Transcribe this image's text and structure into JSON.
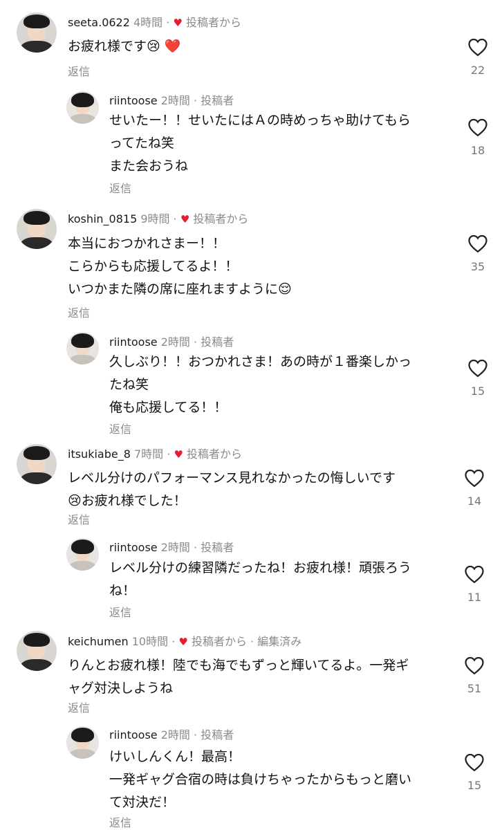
{
  "comments": [
    {
      "username": "seeta.0622",
      "time": "4時間",
      "sep": "·",
      "badge": "投稿者から",
      "lines": [
        "お疲れ様です😢 ❤️"
      ],
      "reply": "返信",
      "likes": "22"
    },
    {
      "username": "riintoose",
      "time": "2時間",
      "sep": "·",
      "badge": "投稿者",
      "lines": [
        "せいたー！！せいたにはＡの時めっちゃ助けてもら",
        "ってたね笑",
        "また会おうね"
      ],
      "reply": "返信",
      "likes": "18"
    },
    {
      "username": "koshin_0815",
      "time": "9時間",
      "sep": "·",
      "badge": "投稿者から",
      "lines": [
        "本当におつかれさまー！！",
        "こらからも応援してるよ！！",
        "いつかまた隣の席に座れますように😌"
      ],
      "reply": "返信",
      "likes": "35"
    },
    {
      "username": "riintoose",
      "time": "2時間",
      "sep": "·",
      "badge": "投稿者",
      "lines": [
        "久しぶり！！おつかれさま！あの時が１番楽しかっ",
        "たね笑",
        "俺も応援してる！！"
      ],
      "reply": "返信",
      "likes": "15"
    },
    {
      "username": "itsukiabe_8",
      "time": "7時間",
      "sep": "·",
      "badge": "投稿者から",
      "lines": [
        "レベル分けのパフォーマンス見れなかったの悔しいです",
        "😢お疲れ様でした！"
      ],
      "reply": "返信",
      "likes": "14"
    },
    {
      "username": "riintoose",
      "time": "2時間",
      "sep": "·",
      "badge": "投稿者",
      "lines": [
        "レベル分けの練習隣だったね！お疲れ様！頑張ろう",
        "ね！"
      ],
      "reply": "返信",
      "likes": "11"
    },
    {
      "username": "keichumen",
      "time": "10時間",
      "sep": "·",
      "badge": "投稿者から",
      "edited": "· 編集済み",
      "lines": [
        "りんとお疲れ様！陸でも海でもずっと輝いてるよ。一発ギ",
        "ャグ対決しようね"
      ],
      "reply": "返信",
      "likes": "51"
    },
    {
      "username": "riintoose",
      "time": "2時間",
      "sep": "·",
      "badge": "投稿者",
      "lines": [
        "けいしんくん！最高！",
        "一発ギャグ合宿の時は負けちゃったからもっと磨い",
        "て対決だ！"
      ],
      "reply": "返信",
      "likes": "15"
    }
  ],
  "icons": {
    "like": "heart-outline-icon",
    "creator_heart": "heart-filled-icon"
  },
  "colors": {
    "creator_heart": "#e0202f",
    "meta": "#8a8a8a",
    "text": "#111111"
  }
}
